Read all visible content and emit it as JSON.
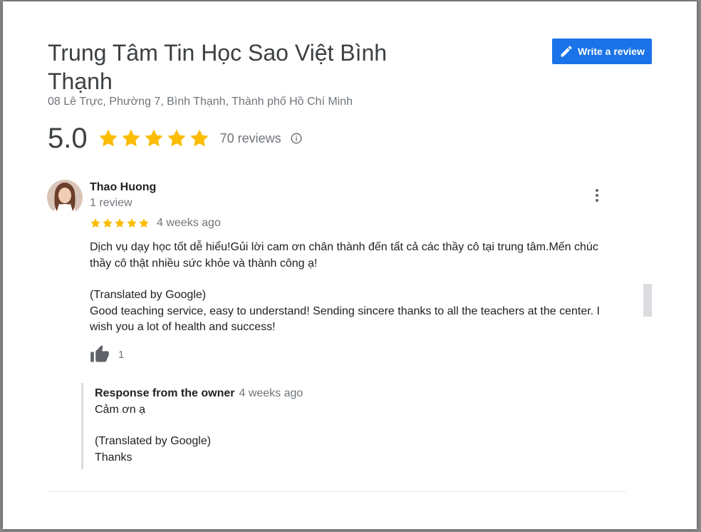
{
  "place": {
    "name": "Trung Tâm Tin Học Sao Việt Bình Thạnh",
    "address": "08 Lê Trực, Phường 7, Bình Thạnh, Thành phố Hồ Chí Minh",
    "rating": "5.0",
    "rating_value": 5,
    "reviews_count": "70 reviews"
  },
  "actions": {
    "write_review": "Write a review",
    "accent_color": "#1a73e8",
    "star_color": "#fbbc04"
  },
  "review": {
    "author": "Thao Huong",
    "author_meta": "1 review",
    "stars": 5,
    "time": "4 weeks ago",
    "original_line1": "Dịch vụ dạy học tốt dễ hiểu!Gủi lời cam ơn chân thành đến tất cả các thầy cô tại trung tâm.Mến chúc",
    "original_line2": "thầy cô thật nhiều sức khỏe và thành công ạ!",
    "translated_label": "(Translated by Google)",
    "translated_line1": "Good teaching service, easy to understand! Sending sincere thanks to all the teachers at the center. I",
    "translated_line2": "wish you a lot of health and success!",
    "likes": "1"
  },
  "owner_response": {
    "label": "Response from the owner",
    "time": "4 weeks ago",
    "original": "Cảm ơn ạ",
    "translated_label": "(Translated by Google)",
    "translated": "Thanks"
  },
  "icons": [
    "edit-pencil-icon",
    "star-icon",
    "info-icon",
    "more-vert-icon",
    "thumbs-up-icon",
    "avatar-photo"
  ]
}
